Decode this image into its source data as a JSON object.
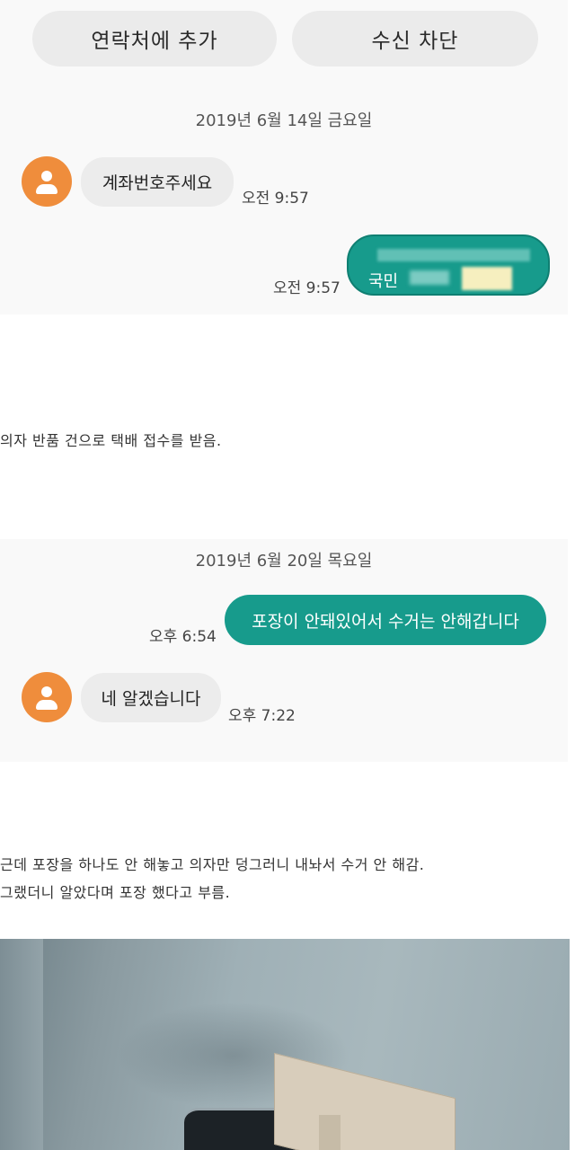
{
  "header": {
    "add_contact": "연락처에 추가",
    "block": "수신 차단"
  },
  "thread1": {
    "date": "2019년 6월 14일 금요일",
    "incoming": {
      "text": "계좌번호주세요",
      "time": "오전 9:57"
    },
    "outgoing": {
      "bank": "국민",
      "time": "오전 9:57"
    }
  },
  "caption1": "의자 반품 건으로 택배 접수를 받음.",
  "thread2": {
    "date": "2019년 6월 20일 목요일",
    "outgoing": {
      "text": "포장이 안돼있어서 수거는 안해갑니다",
      "time": "오후 6:54"
    },
    "incoming": {
      "text": "네 알겠습니다",
      "time": "오후 7:22"
    }
  },
  "caption2": [
    "근데 포장을 하나도 안 해놓고 의자만 덩그러니 내놔서 수거 안 해감.",
    "그랬더니 알았다며 포장 했다고 부름."
  ],
  "colors": {
    "avatar": "#ef8d3c",
    "outgoing_bubble": "#179b8c",
    "incoming_bubble": "#ececec",
    "button_bg": "#ebebeb"
  },
  "icons": {
    "avatar": "person-icon"
  }
}
